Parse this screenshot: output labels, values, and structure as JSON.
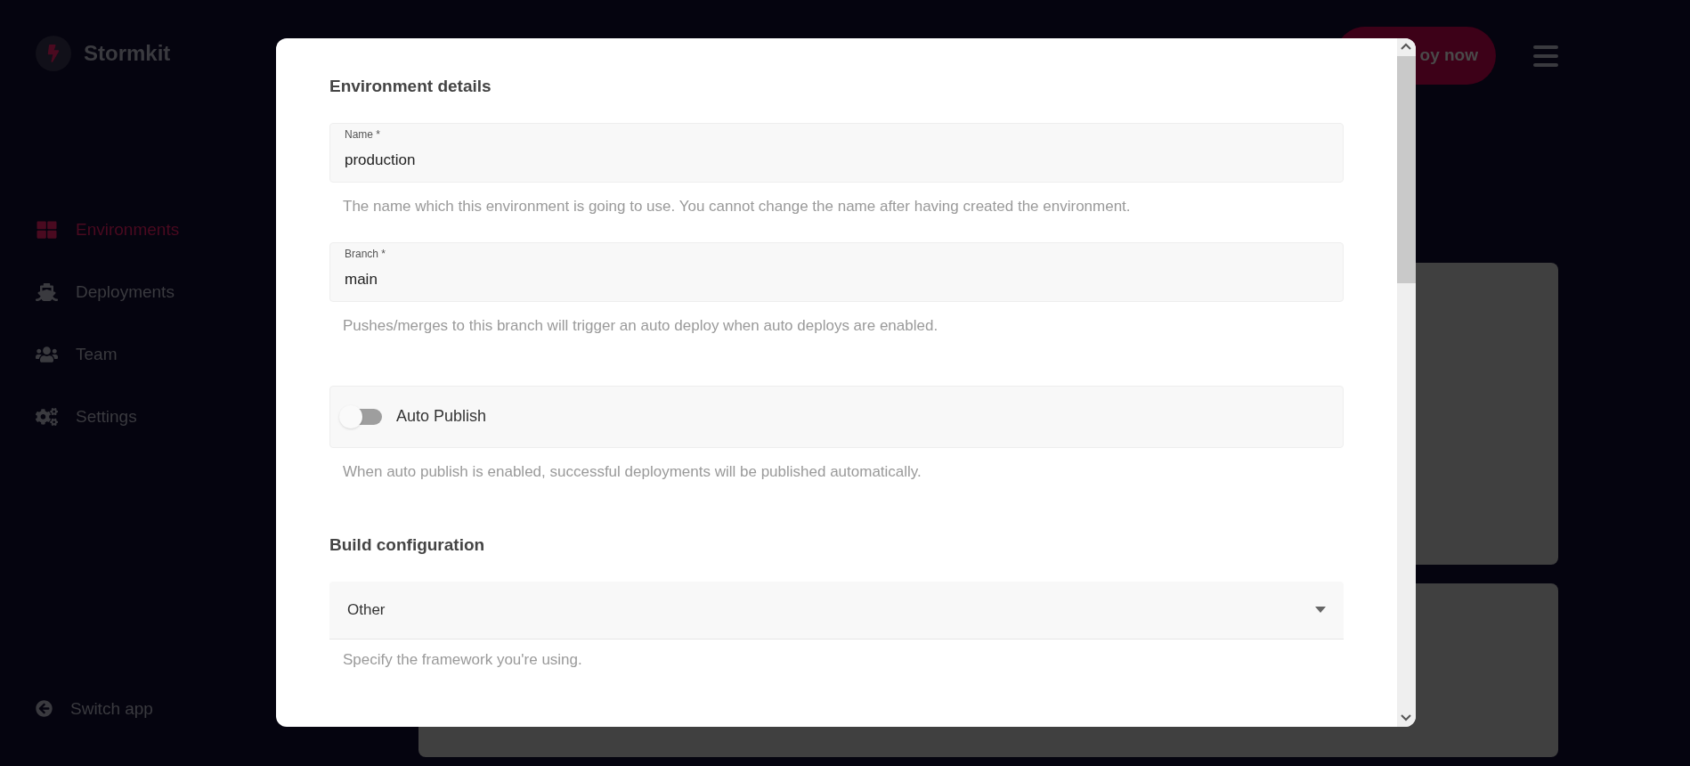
{
  "brand": {
    "name": "Stormkit"
  },
  "sidebar": {
    "items": [
      {
        "label": "Environments",
        "selected": true
      },
      {
        "label": "Deployments",
        "selected": false
      },
      {
        "label": "Team",
        "selected": false
      },
      {
        "label": "Settings",
        "selected": false
      }
    ],
    "footer_link": "Switch app"
  },
  "header": {
    "deploy_button": "oy now"
  },
  "modal": {
    "items": [
      {
        "kind": "heading",
        "text": "Environment details"
      },
      {
        "kind": "text_field",
        "label": "Name *",
        "value": "production",
        "help": "The name which this environment is going to use. You cannot change the name after having created the environment."
      },
      {
        "kind": "text_field",
        "label": "Branch *",
        "value": "main",
        "help": "Pushes/merges to this branch will trigger an auto deploy when auto deploys are enabled."
      },
      {
        "kind": "toggle",
        "label": "Auto Publish",
        "on": false,
        "help": "When auto publish is enabled, successful deployments will be published automatically."
      },
      {
        "kind": "heading",
        "text": "Build configuration"
      },
      {
        "kind": "select",
        "value": "Other",
        "help": "Specify the framework you're using."
      }
    ]
  }
}
